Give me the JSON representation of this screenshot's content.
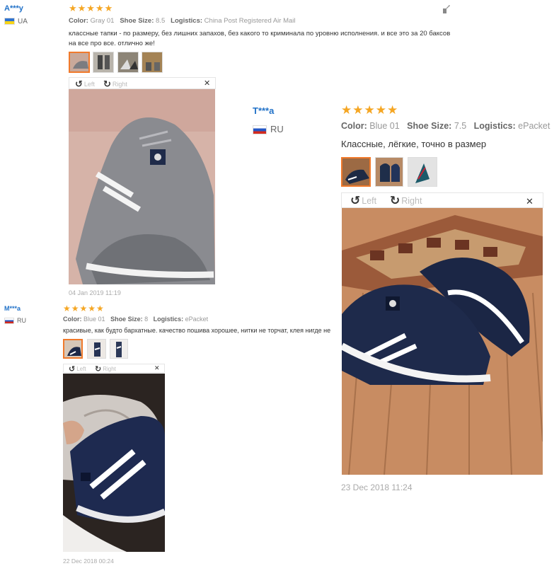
{
  "reviews": [
    {
      "user": "A***y",
      "country": "UA",
      "stars": "★★★★★",
      "color_label": "Color:",
      "color_value": "Gray 01",
      "size_label": "Shoe Size:",
      "size_value": "8.5",
      "logistics_label": "Logistics:",
      "logistics_value": "China Post Registered Air Mail",
      "text": "классные тапки - по размеру, без лишних запахов, без какого то криминала по уровню исполнения. и все это за 20 баксов на все про все. отлично же!",
      "rotate_left": "Left",
      "rotate_right": "Right",
      "date": "04 Jan 2019 11:19"
    },
    {
      "user": "T***a",
      "country": "RU",
      "stars": "★★★★★",
      "color_label": "Color:",
      "color_value": "Blue 01",
      "size_label": "Shoe Size:",
      "size_value": "7.5",
      "logistics_label": "Logistics:",
      "logistics_value": "ePacket",
      "text": "Классные, лёгкие, точно в размер",
      "rotate_left": "Left",
      "rotate_right": "Right",
      "date": "23 Dec 2018 11:24"
    },
    {
      "user": "M***a",
      "country": "RU",
      "stars": "★★★★★",
      "color_label": "Color:",
      "color_value": "Blue 01",
      "size_label": "Shoe Size:",
      "size_value": "8",
      "logistics_label": "Logistics:",
      "logistics_value": "ePacket",
      "text": "красивые, как будто бархатные. качество пошива хорошее, нитки не торчат, клея нигде не",
      "rotate_left": "Left",
      "rotate_right": "Right",
      "date": "22 Dec 2018 00:24"
    }
  ],
  "colors": {
    "username": "#2272c8",
    "stars": "#f5a623",
    "selected_thumb": "#f07a2c"
  },
  "icons": {
    "rotate_left": "rotate-left-icon",
    "rotate_right": "rotate-right-icon",
    "close": "close-icon",
    "report": "report-icon"
  }
}
